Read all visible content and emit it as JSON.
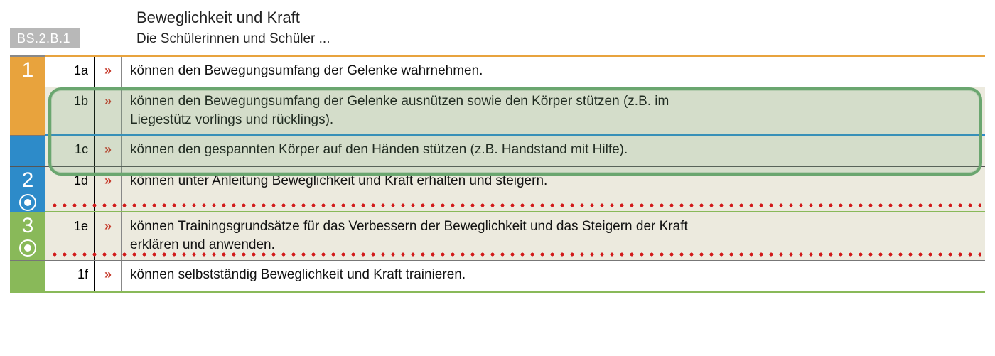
{
  "header": {
    "code": "BS.2.B.1",
    "title": "Beweglichkeit und Kraft",
    "subtitle": "Die Schülerinnen und Schüler ..."
  },
  "bullet_glyph": "»",
  "cycles": {
    "c1": "1",
    "c2": "2",
    "c3": "3"
  },
  "rows": {
    "r1a": {
      "code": "1a",
      "text": "können den Bewegungsumfang der Gelenke wahrnehmen."
    },
    "r1b": {
      "code": "1b",
      "text": "können den Bewegungsumfang der Gelenke ausnützen sowie den Körper stützen (z.B. im Liegestütz vorlings und rücklings)."
    },
    "r1c": {
      "code": "1c",
      "text": "können den gespannten Körper auf den Händen stützen (z.B. Handstand mit Hilfe)."
    },
    "r1d": {
      "code": "1d",
      "text": "können unter Anleitung Beweglichkeit und Kraft erhalten und steigern."
    },
    "r1e": {
      "code": "1e",
      "text": "können Trainingsgrundsätze für das Verbessern der Beweglichkeit und das Steigern der Kraft erklären und anwenden."
    },
    "r1f": {
      "code": "1f",
      "text": "können selbstständig Beweglichkeit und Kraft trainieren."
    }
  }
}
